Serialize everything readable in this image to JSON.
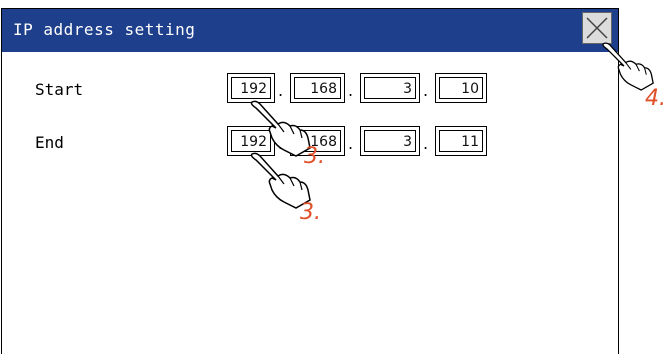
{
  "dialog": {
    "title": "IP address setting",
    "close_icon": "close-x-icon"
  },
  "fields": {
    "start": {
      "label": "Start",
      "octets": [
        "192",
        "168",
        "3",
        "10"
      ]
    },
    "end": {
      "label": "End",
      "octets": [
        "192",
        "168",
        "3",
        "11"
      ]
    },
    "separator": "."
  },
  "annotations": {
    "step_touch_field": "3.",
    "step_touch_field_b": "3.",
    "step_close": "4."
  },
  "colors": {
    "titlebar": "#1e3f8c",
    "annotation": "#e0502a"
  }
}
